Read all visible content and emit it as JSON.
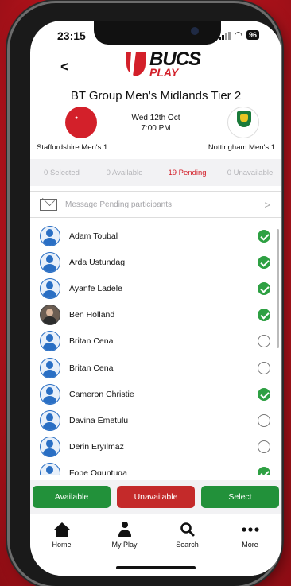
{
  "status": {
    "time": "23:15",
    "battery": "96"
  },
  "header": {
    "back": "<",
    "logo_main": "BUCS",
    "logo_sub": "PLAY"
  },
  "fixture": {
    "title": "BT Group Men's Midlands Tier 2",
    "date": "Wed 12th Oct",
    "time": "7:00 PM",
    "home_team": "Staffordshire Men's 1",
    "away_team": "Nottingham Men's 1"
  },
  "filters": [
    {
      "label": "0 Selected",
      "active": false
    },
    {
      "label": "0 Available",
      "active": false
    },
    {
      "label": "19 Pending",
      "active": true
    },
    {
      "label": "0 Unavailable",
      "active": false
    }
  ],
  "message": {
    "placeholder": "Message Pending participants",
    "chevron": ">"
  },
  "participants": [
    {
      "name": "Adam Toubal",
      "checked": true,
      "photo": false
    },
    {
      "name": "Arda Ustundag",
      "checked": true,
      "photo": false
    },
    {
      "name": "Ayanfe Ladele",
      "checked": true,
      "photo": false
    },
    {
      "name": "Ben Holland",
      "checked": true,
      "photo": true
    },
    {
      "name": "Britan Cena",
      "checked": false,
      "photo": false
    },
    {
      "name": "Britan Cena",
      "checked": false,
      "photo": false
    },
    {
      "name": "Cameron Christie",
      "checked": true,
      "photo": false
    },
    {
      "name": "Davina Emetulu",
      "checked": false,
      "photo": false
    },
    {
      "name": "Derin Eryılmaz",
      "checked": false,
      "photo": false
    },
    {
      "name": "Fope Oguntuga",
      "checked": true,
      "photo": false
    }
  ],
  "actions": {
    "available": "Available",
    "unavailable": "Unavailable",
    "select": "Select"
  },
  "tabs": [
    {
      "label": "Home",
      "icon": "home-icon"
    },
    {
      "label": "My Play",
      "icon": "user-icon"
    },
    {
      "label": "Search",
      "icon": "search-icon"
    },
    {
      "label": "More",
      "icon": "more-icon"
    }
  ],
  "colors": {
    "brand_red": "#d3202a",
    "check_green": "#2ea043",
    "button_green": "#22913a",
    "button_red": "#c42a2a"
  }
}
